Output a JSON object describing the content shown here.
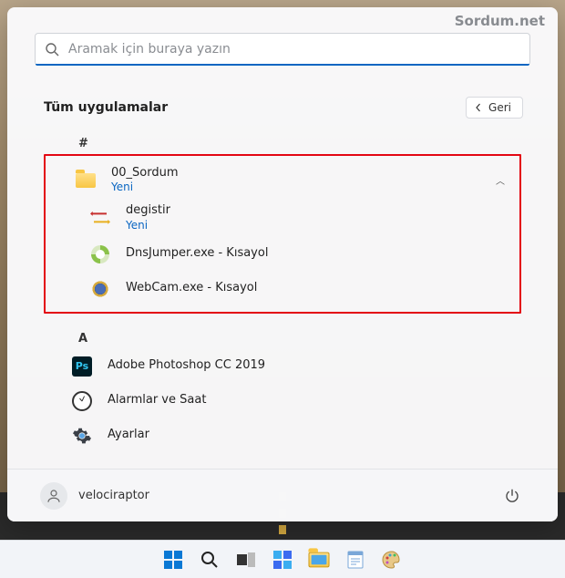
{
  "watermark": "Sordum.net",
  "search": {
    "placeholder": "Aramak için buraya yazın"
  },
  "header": {
    "title": "Tüm uygulamalar",
    "back": "Geri"
  },
  "groups": {
    "hash": {
      "label": "#"
    },
    "a": {
      "label": "A"
    }
  },
  "folder": {
    "name": "00_Sordum",
    "badge": "Yeni",
    "items": [
      {
        "name": "degistir",
        "badge": "Yeni",
        "icon": "swap"
      },
      {
        "name": "DnsJumper.exe - Kısayol",
        "icon": "dns"
      },
      {
        "name": "WebCam.exe - Kısayol",
        "icon": "webcam"
      }
    ]
  },
  "apps_a": [
    {
      "name": "Adobe Photoshop CC 2019",
      "icon": "ps"
    },
    {
      "name": "Alarmlar ve Saat",
      "icon": "clock"
    },
    {
      "name": "Ayarlar",
      "icon": "gear"
    }
  ],
  "user": {
    "name": "velociraptor"
  }
}
